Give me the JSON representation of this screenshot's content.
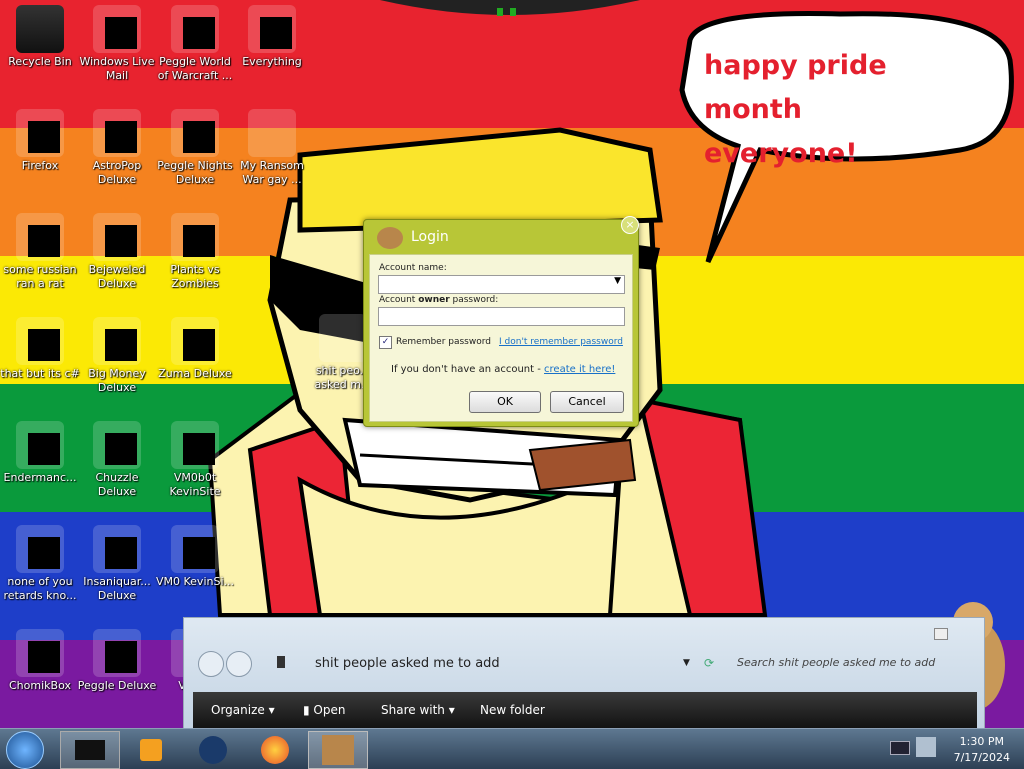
{
  "desktop_icons": [
    {
      "label": "Recycle Bin",
      "icon": "recycle-bin-icon"
    },
    {
      "label": "Windows Live Mail",
      "icon": "mail-icon"
    },
    {
      "label": "Peggle World of Warcraft ...",
      "icon": "peggle-icon"
    },
    {
      "label": "Everything",
      "icon": "search-icon"
    },
    {
      "label": "Firefox",
      "icon": "firefox-icon"
    },
    {
      "label": "AstroPop Deluxe",
      "icon": "game-icon"
    },
    {
      "label": "Peggle Nights Deluxe",
      "icon": "peggle-icon"
    },
    {
      "label": "My Ransom War gay ...",
      "icon": "terminal-icon"
    },
    {
      "label": "some russian ran a rat",
      "icon": "app-icon"
    },
    {
      "label": "Bejeweled Deluxe",
      "icon": "gem-icon"
    },
    {
      "label": "Plants vs Zombies",
      "icon": "plant-icon"
    },
    {
      "label": "that but its c#",
      "icon": "window-icon"
    },
    {
      "label": "Big Money Deluxe",
      "icon": "money-bag-icon"
    },
    {
      "label": "Zuma Deluxe",
      "icon": "zuma-icon"
    },
    {
      "label": "Endermanc...",
      "icon": "terminal-icon"
    },
    {
      "label": "Chuzzle Deluxe",
      "icon": "chuzzle-icon"
    },
    {
      "label": "VM0b0t KevinSite",
      "icon": "vm-icon"
    },
    {
      "label": "none of you retards kno...",
      "icon": "ball-icon"
    },
    {
      "label": "Insaniquar... Deluxe",
      "icon": "fish-icon"
    },
    {
      "label": "VM0 KevinSi...",
      "icon": "vm-icon"
    },
    {
      "label": "ChomikBox",
      "icon": "hamster-icon"
    },
    {
      "label": "Peggle Deluxe",
      "icon": "peggle-icon"
    },
    {
      "label": "Visu...",
      "icon": "app-icon"
    },
    {
      "label": "shit peo... asked m...",
      "icon": "folder-icon"
    }
  ],
  "bubble": {
    "line1": "happy pride month",
    "line2": "everyone!"
  },
  "login": {
    "title": "Login",
    "account_label": "Account name:",
    "password_label_pre": "Account ",
    "password_label_bold": "owner",
    "password_label_post": " password:",
    "remember": "Remember password",
    "forgot": "I don't remember password",
    "no_account": "If you don't have an account - ",
    "create": "create it here!",
    "ok": "OK",
    "cancel": "Cancel"
  },
  "explorer": {
    "address": "shit people asked me to add",
    "search_placeholder": "Search shit people asked me to add",
    "commands": [
      "Organize",
      "Open",
      "Share with",
      "New folder"
    ]
  },
  "clock": {
    "time": "1:30 PM",
    "date": "7/17/2024"
  },
  "colors": {
    "red": "#e8232f",
    "orange": "#f5821f",
    "yellow": "#fbe905",
    "green": "#0a9a3c",
    "blue": "#1e3ec9",
    "purple": "#7a1aa0",
    "skin": "#fcf3b0",
    "hair": "#fae52c",
    "shirt": "#ec2535",
    "accent_green": "#b8c637"
  }
}
